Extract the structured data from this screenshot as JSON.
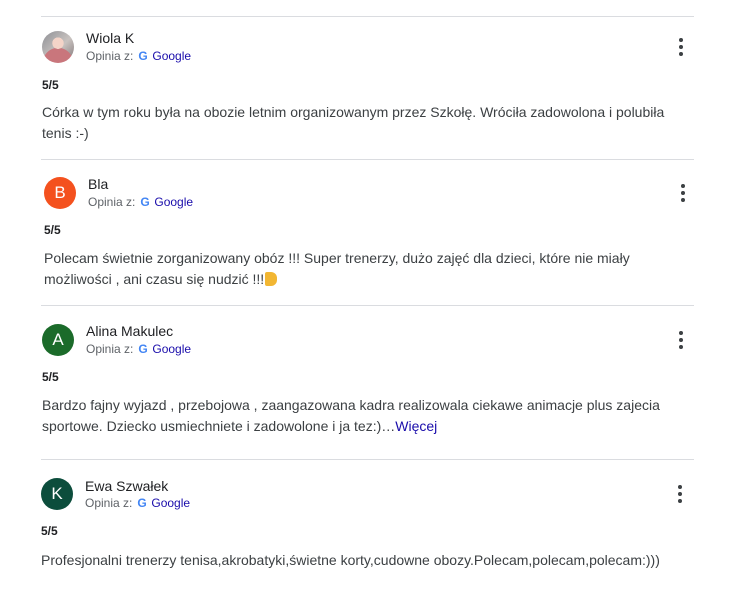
{
  "reviews": [
    {
      "author": "Wiola K",
      "avatar_letter": "",
      "avatar_color": "#8d8f95",
      "source_prefix": "Opinia z:",
      "source_name": "Google",
      "rating": "5/5",
      "text": "Córka w tym roku była na obozie letnim organizowanym przez Szkołę. Wróciła zadowolona i polubiła tenis :-)",
      "more_label": ""
    },
    {
      "author": "Bla",
      "avatar_letter": "B",
      "avatar_color": "#f4511e",
      "source_prefix": "Opinia z:",
      "source_name": "Google",
      "rating": "5/5",
      "text": "Polecam świetnie zorganizowany obóz !!! Super trenerzy, dużo zajęć dla dzieci, które nie miały możliwości , ani czasu się nudzić !!!",
      "more_label": ""
    },
    {
      "author": "Alina Makulec",
      "avatar_letter": "A",
      "avatar_color": "#1b6b2a",
      "source_prefix": "Opinia z:",
      "source_name": "Google",
      "rating": "5/5",
      "text": "Bardzo fajny wyjazd , przebojowa , zaangazowana kadra realizowala ciekawe animacje plus zajecia sportowe. Dziecko usmiechniete i zadowolone i ja tez:)…",
      "more_label": "Więcej"
    },
    {
      "author": "Ewa Szwałek",
      "avatar_letter": "K",
      "avatar_color": "#0c4d3c",
      "source_prefix": "Opinia z:",
      "source_name": "Google",
      "rating": "5/5",
      "text": "Profesjonalni trenerzy tenisa,akrobatyki,świetne korty,cudowne obozy.Polecam,polecam,polecam:)))",
      "more_label": ""
    }
  ],
  "google_logo_letter": "G",
  "colors": {
    "divider": "#dadce0",
    "link": "#1a0dab",
    "google_blue": "#4285f4"
  }
}
